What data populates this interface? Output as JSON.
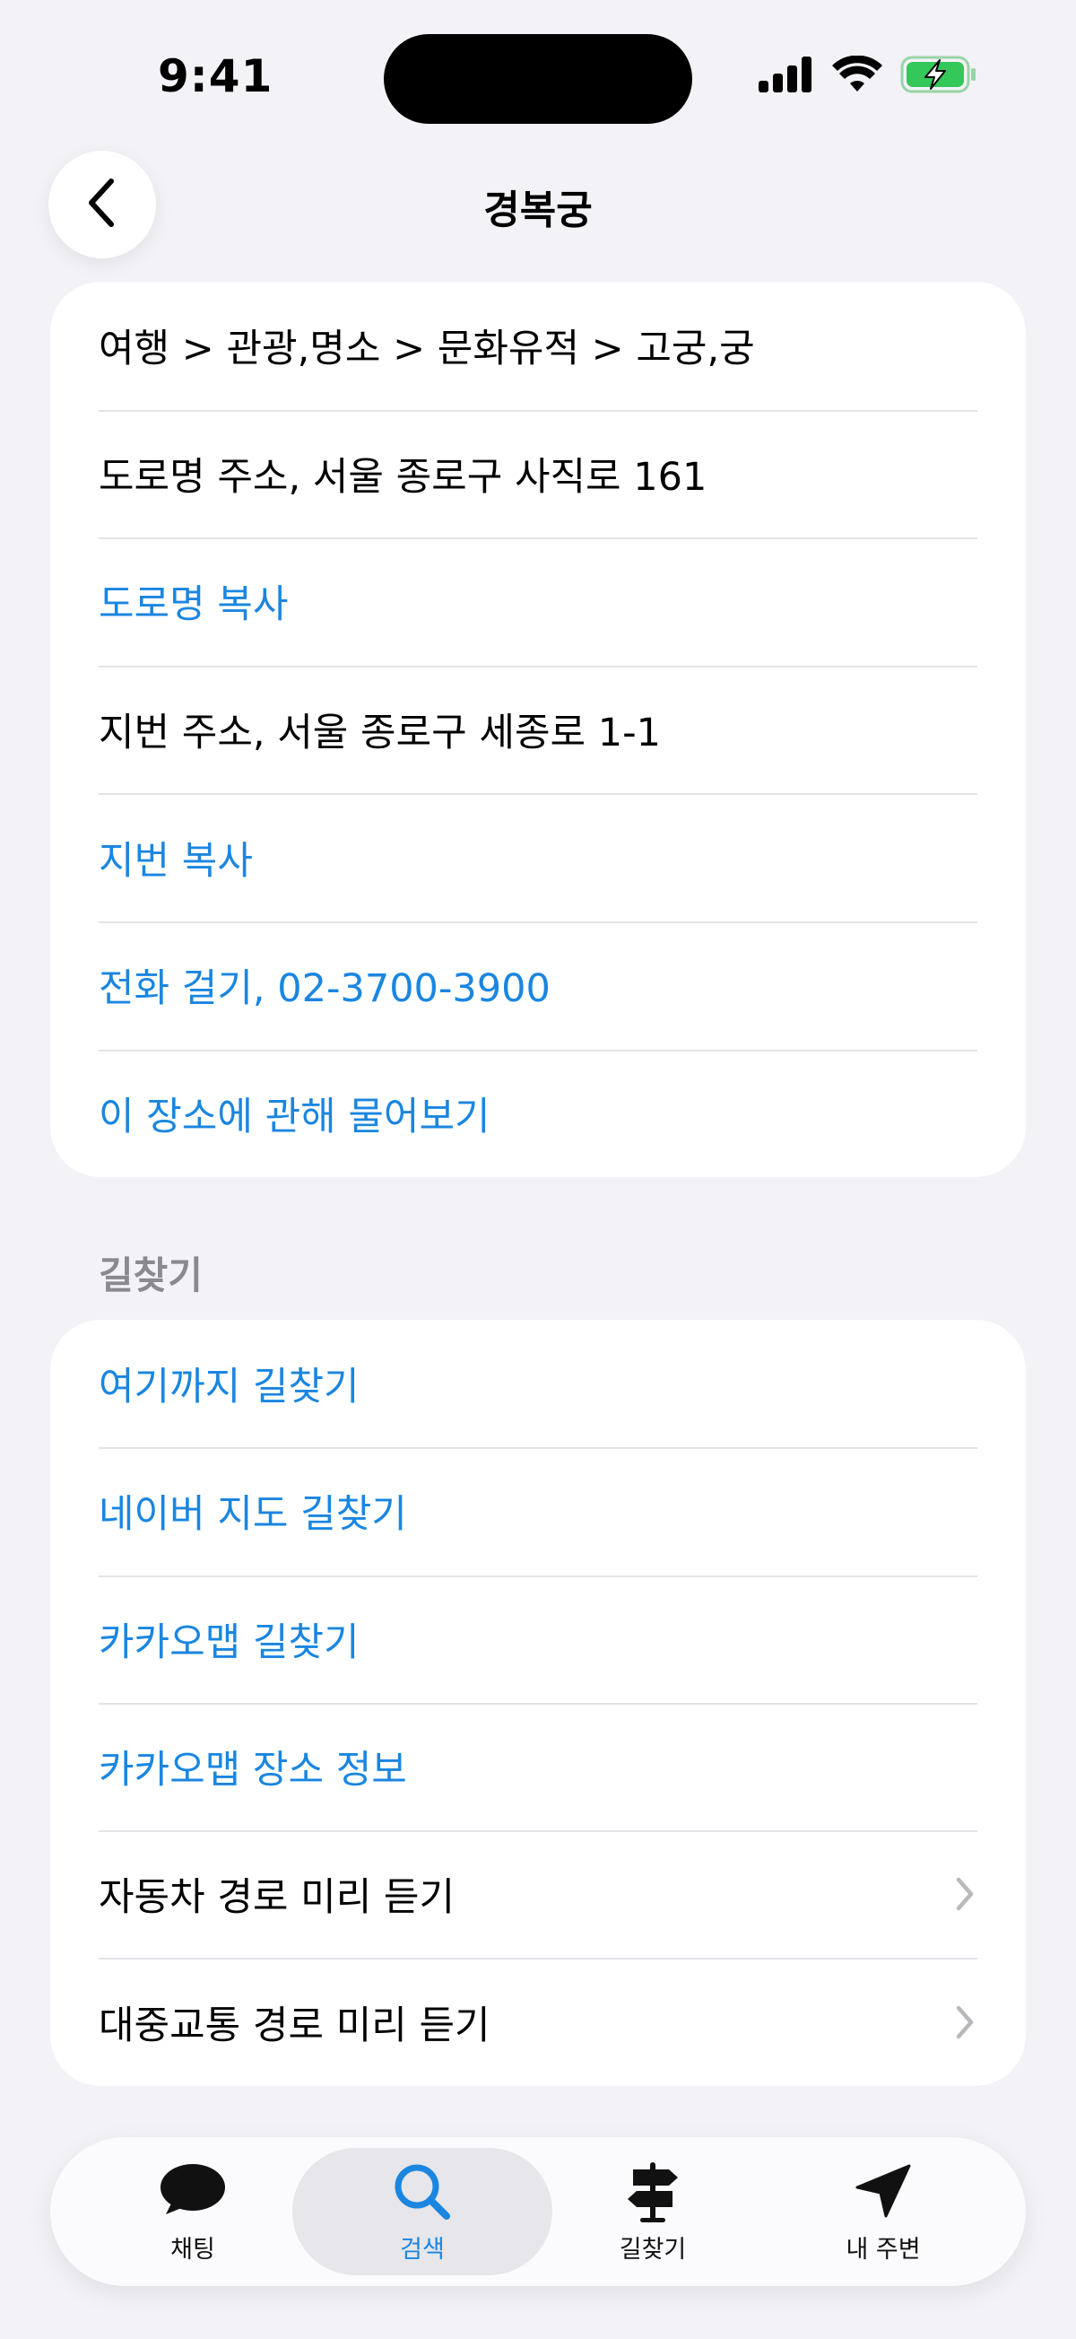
{
  "status_bar": {
    "time": "9:41"
  },
  "header": {
    "title": "경복궁",
    "back_icon": "chevron-left-icon"
  },
  "info_card": {
    "rows": [
      {
        "label": "여행 > 관광,명소 > 문화유적 > 고궁,궁",
        "link": false
      },
      {
        "label": "도로명 주소, 서울 종로구 사직로 161",
        "link": false
      },
      {
        "label": "도로명 복사",
        "link": true
      },
      {
        "label": "지번 주소, 서울 종로구 세종로 1-1",
        "link": false
      },
      {
        "label": "지번 복사",
        "link": true
      },
      {
        "label": "전화 걸기, 02-3700-3900",
        "link": true
      },
      {
        "label": "이 장소에 관해 물어보기",
        "link": true
      }
    ]
  },
  "directions_section": {
    "title": "길찾기",
    "rows": [
      {
        "label": "여기까지 길찾기",
        "link": true
      },
      {
        "label": "네이버 지도 길찾기",
        "link": true
      },
      {
        "label": "카카오맵 길찾기",
        "link": true
      },
      {
        "label": "카카오맵 장소 정보",
        "link": true
      },
      {
        "label": "자동차 경로 미리 듣기",
        "link": false,
        "chevron": true
      },
      {
        "label": "대중교통 경로 미리 듣기",
        "link": false,
        "chevron": true
      }
    ]
  },
  "tab_bar": {
    "tabs": [
      {
        "label": "채팅",
        "icon": "chat-bubble-icon",
        "active": false
      },
      {
        "label": "검색",
        "icon": "search-icon",
        "active": true
      },
      {
        "label": "길찾기",
        "icon": "signpost-icon",
        "active": false
      },
      {
        "label": "내 주변",
        "icon": "location-arrow-icon",
        "active": false
      }
    ]
  },
  "colors": {
    "link": "#1a86e0",
    "background": "#f2f2f7",
    "battery": "#34c759"
  }
}
